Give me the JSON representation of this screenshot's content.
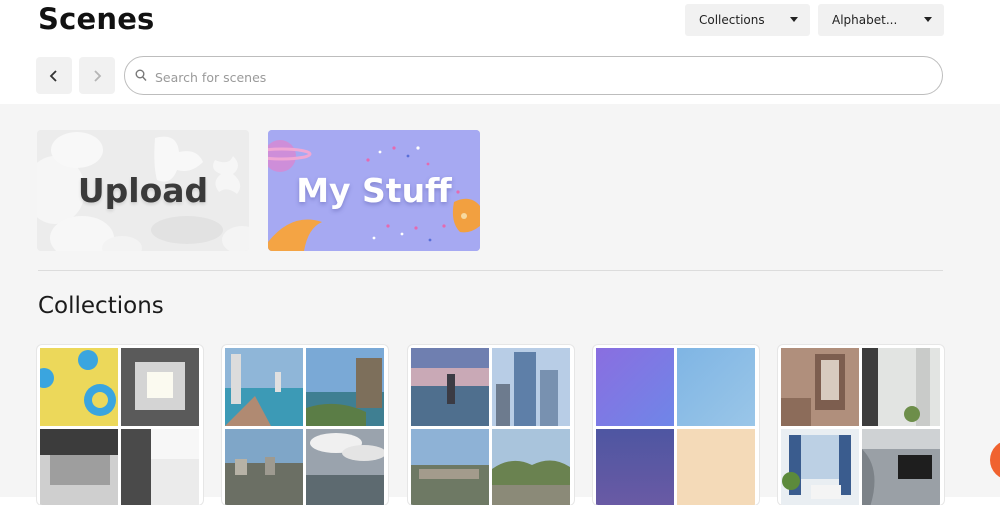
{
  "page": {
    "title": "Scenes"
  },
  "filters": {
    "collections_label": "Collections",
    "sort_label": "Alphabet..."
  },
  "search": {
    "placeholder": "Search for scenes"
  },
  "tiles": {
    "upload_label": "Upload",
    "mystuff_label": "My Stuff"
  },
  "collections_section": {
    "title": "Collections"
  },
  "colors": {
    "accent_fab": "#f0622f",
    "mystuff_bg": "#a6a9f2"
  }
}
